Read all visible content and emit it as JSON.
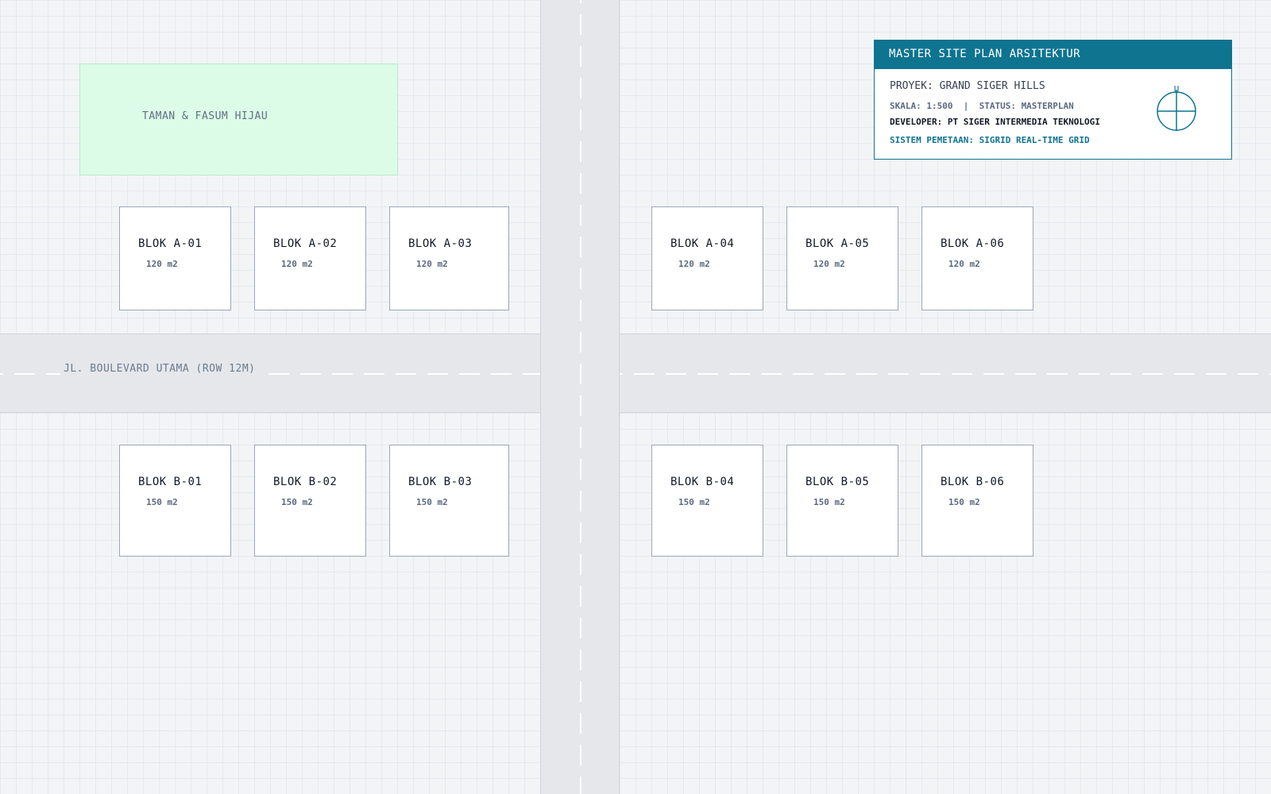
{
  "roads": {
    "boulevard_label": "JL. BOULEVARD UTAMA (ROW 12M)"
  },
  "green_area": {
    "label": "TAMAN & FASUM HIJAU"
  },
  "blocks_a": [
    {
      "name": "BLOK A-01",
      "area": "120 m2"
    },
    {
      "name": "BLOK A-02",
      "area": "120 m2"
    },
    {
      "name": "BLOK A-03",
      "area": "120 m2"
    },
    {
      "name": "BLOK A-04",
      "area": "120 m2"
    },
    {
      "name": "BLOK A-05",
      "area": "120 m2"
    },
    {
      "name": "BLOK A-06",
      "area": "120 m2"
    }
  ],
  "blocks_b": [
    {
      "name": "BLOK B-01",
      "area": "150 m2"
    },
    {
      "name": "BLOK B-02",
      "area": "150 m2"
    },
    {
      "name": "BLOK B-03",
      "area": "150 m2"
    },
    {
      "name": "BLOK B-04",
      "area": "150 m2"
    },
    {
      "name": "BLOK B-05",
      "area": "150 m2"
    },
    {
      "name": "BLOK B-06",
      "area": "150 m2"
    }
  ],
  "info_panel": {
    "title": "MASTER SITE PLAN ARSITEKTUR",
    "project": "PROYEK: GRAND SIGER HILLS",
    "meta": "SKALA: 1:500  |  STATUS: MASTERPLAN",
    "developer": "DEVELOPER: PT SIGER INTERMEDIA TEKNOLOGI",
    "system": "SISTEM PEMETAAN: SIGRID REAL-TIME GRID",
    "compass_letter": "U",
    "compass_icon": "north-arrow-icon"
  },
  "colors": {
    "accent": "#0e7490",
    "green_area": "#dcfce7",
    "road": "#e5e7eb",
    "background": "#f3f4f6",
    "lot": "#ffffff"
  }
}
